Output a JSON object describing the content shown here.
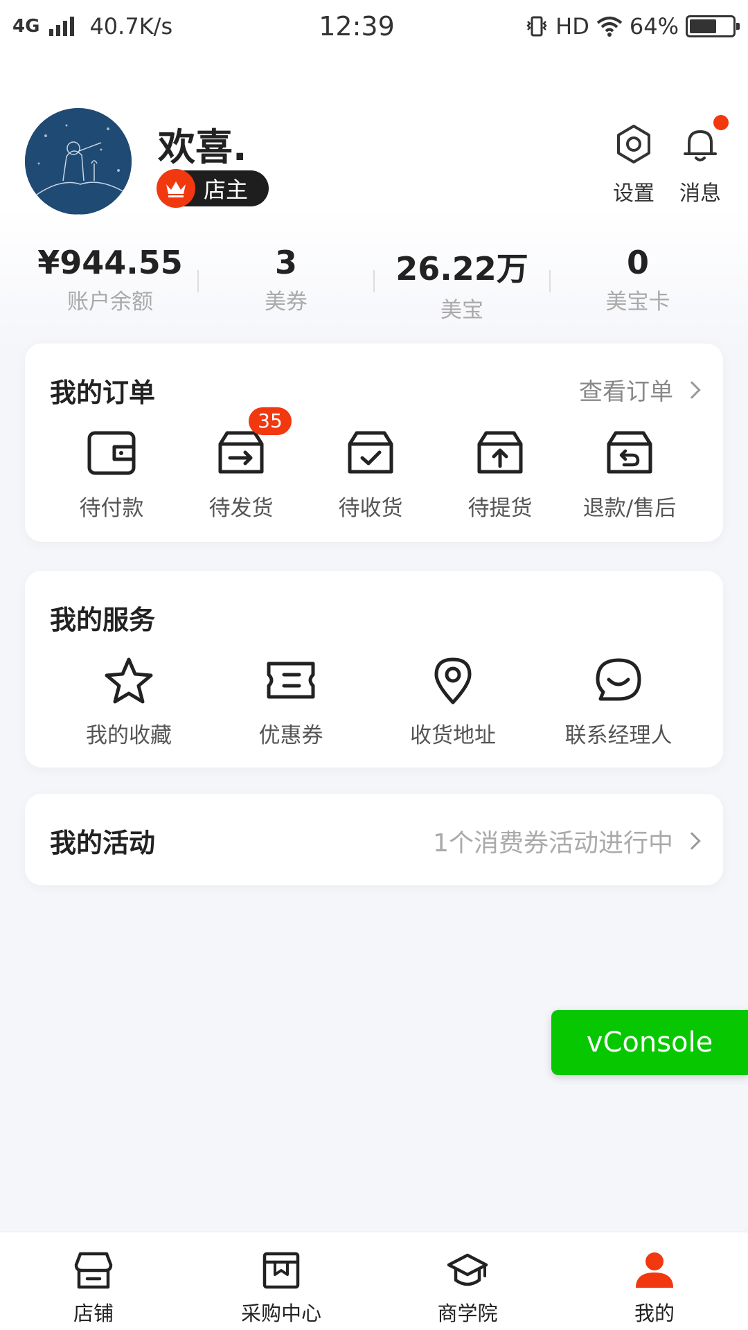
{
  "status_bar": {
    "network": "4G",
    "speed": "40.7K/s",
    "time": "12:39",
    "hd": "HD",
    "battery": "64%",
    "battery_level": 0.64
  },
  "profile": {
    "username": "欢喜.",
    "role_badge": "店主",
    "actions": {
      "settings": "设置",
      "messages": "消息"
    }
  },
  "stats": [
    {
      "value": "¥944.55",
      "label": "账户余额"
    },
    {
      "value": "3",
      "label": "美券"
    },
    {
      "value": "26.22万",
      "label": "美宝"
    },
    {
      "value": "0",
      "label": "美宝卡"
    }
  ],
  "orders": {
    "title": "我的订单",
    "link": "查看订单",
    "items": [
      {
        "label": "待付款",
        "icon": "wallet-icon"
      },
      {
        "label": "待发货",
        "icon": "ship-box-icon",
        "badge": "35"
      },
      {
        "label": "待收货",
        "icon": "receive-box-icon"
      },
      {
        "label": "待提货",
        "icon": "pickup-box-icon"
      },
      {
        "label": "退款/售后",
        "icon": "refund-box-icon"
      }
    ]
  },
  "services": {
    "title": "我的服务",
    "items": [
      {
        "label": "我的收藏",
        "icon": "star-icon"
      },
      {
        "label": "优惠券",
        "icon": "coupon-icon"
      },
      {
        "label": "收货地址",
        "icon": "location-pin-icon"
      },
      {
        "label": "联系经理人",
        "icon": "chat-bubble-icon"
      }
    ]
  },
  "activities": {
    "title": "我的活动",
    "status": "1个消费券活动进行中"
  },
  "vconsole": {
    "label": "vConsole"
  },
  "tabbar": {
    "items": [
      {
        "label": "店铺",
        "icon": "store-icon"
      },
      {
        "label": "采购中心",
        "icon": "purchase-book-icon"
      },
      {
        "label": "商学院",
        "icon": "graduation-cap-icon"
      },
      {
        "label": "我的",
        "icon": "user-icon",
        "active": true
      }
    ]
  },
  "colors": {
    "accent": "#f2380f",
    "vconsole": "#07c700",
    "background": "#f5f6fa"
  }
}
